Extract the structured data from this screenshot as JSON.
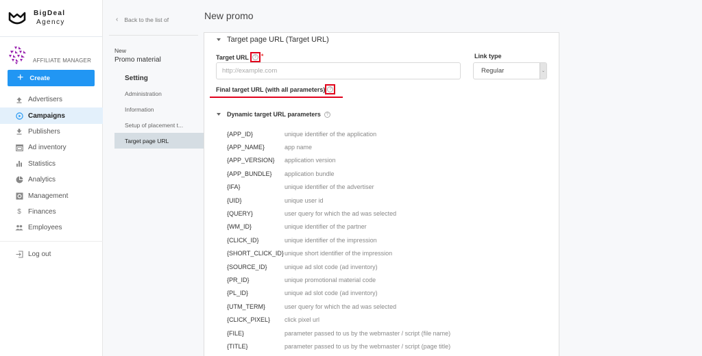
{
  "brand": {
    "name": "BigDeal",
    "sub": "Agency"
  },
  "role": {
    "label": "AFFILIATE MANAGER"
  },
  "create_button": {
    "label": "Create",
    "icon": "plus-icon"
  },
  "nav": {
    "items": [
      {
        "label": "Advertisers",
        "icon": "upload-icon",
        "active": false
      },
      {
        "label": "Campaigns",
        "icon": "play-circle-icon",
        "active": true
      },
      {
        "label": "Publishers",
        "icon": "download-icon",
        "active": false
      },
      {
        "label": "Ad inventory",
        "icon": "web-icon",
        "active": false
      },
      {
        "label": "Statistics",
        "icon": "bar-chart-icon",
        "active": false
      },
      {
        "label": "Analytics",
        "icon": "pie-chart-icon",
        "active": false
      },
      {
        "label": "Management",
        "icon": "settings-box-icon",
        "active": false
      },
      {
        "label": "Finances",
        "icon": "dollar-icon",
        "active": false
      },
      {
        "label": "Employees",
        "icon": "people-icon",
        "active": false
      }
    ],
    "logout": {
      "label": "Log out",
      "icon": "logout-icon"
    }
  },
  "subnav": {
    "back_label": "Back to the list of",
    "new_label": "New",
    "title": "Promo material",
    "setting_label": "Setting",
    "items": [
      {
        "label": "Administration",
        "active": false
      },
      {
        "label": "Information",
        "active": false
      },
      {
        "label": "Setup of placement t...",
        "active": false
      },
      {
        "label": "Target page URL",
        "active": true
      }
    ]
  },
  "page": {
    "title": "New promo"
  },
  "section": {
    "title": "Target page URL (Target URL)",
    "target_url": {
      "label": "Target URL",
      "required_mark": "*",
      "placeholder": "http://example.com",
      "value": ""
    },
    "link_type": {
      "label": "Link type",
      "selected": "Regular"
    },
    "final_url": {
      "label": "Final target URL (with all parameters)"
    },
    "help_icon_glyph": "?",
    "dynamic": {
      "title": "Dynamic target URL parameters",
      "params": [
        {
          "key": "{APP_ID}",
          "desc": "unique identifier of the application"
        },
        {
          "key": "{APP_NAME}",
          "desc": "app name"
        },
        {
          "key": "{APP_VERSION}",
          "desc": "application version"
        },
        {
          "key": "{APP_BUNDLE}",
          "desc": "application bundle"
        },
        {
          "key": "{IFA}",
          "desc": "unique identifier of the advertiser"
        },
        {
          "key": "{UID}",
          "desc": "unique user id"
        },
        {
          "key": "{QUERY}",
          "desc": "user query for which the ad was selected"
        },
        {
          "key": "{WM_ID}",
          "desc": "unique identifier of the partner"
        },
        {
          "key": "{CLICK_ID}",
          "desc": "unique identifier of the impression"
        },
        {
          "key": "{SHORT_CLICK_ID}",
          "desc": "unique short identifier of the impression"
        },
        {
          "key": "{SOURCE_ID}",
          "desc": "unique ad slot code (ad inventory)"
        },
        {
          "key": "{PR_ID}",
          "desc": "unique promotional material code"
        },
        {
          "key": "{PL_ID}",
          "desc": "unique ad slot code (ad inventory)"
        },
        {
          "key": "{UTM_TERM}",
          "desc": "user query for which the ad was selected"
        },
        {
          "key": "{CLICK_PIXEL}",
          "desc": "click pixel url"
        },
        {
          "key": "{FILE}",
          "desc": "parameter passed to us by the webmaster / script (file name)"
        },
        {
          "key": "{TITLE}",
          "desc": "parameter passed to us by the webmaster / script (page title)"
        }
      ]
    }
  },
  "colors": {
    "accent": "#2196f3",
    "highlight": "#e0001b",
    "active_nav_bg": "#e3f0fb",
    "active_subnav_bg": "#d5dde3",
    "logo_purple": "#9b27b0"
  }
}
